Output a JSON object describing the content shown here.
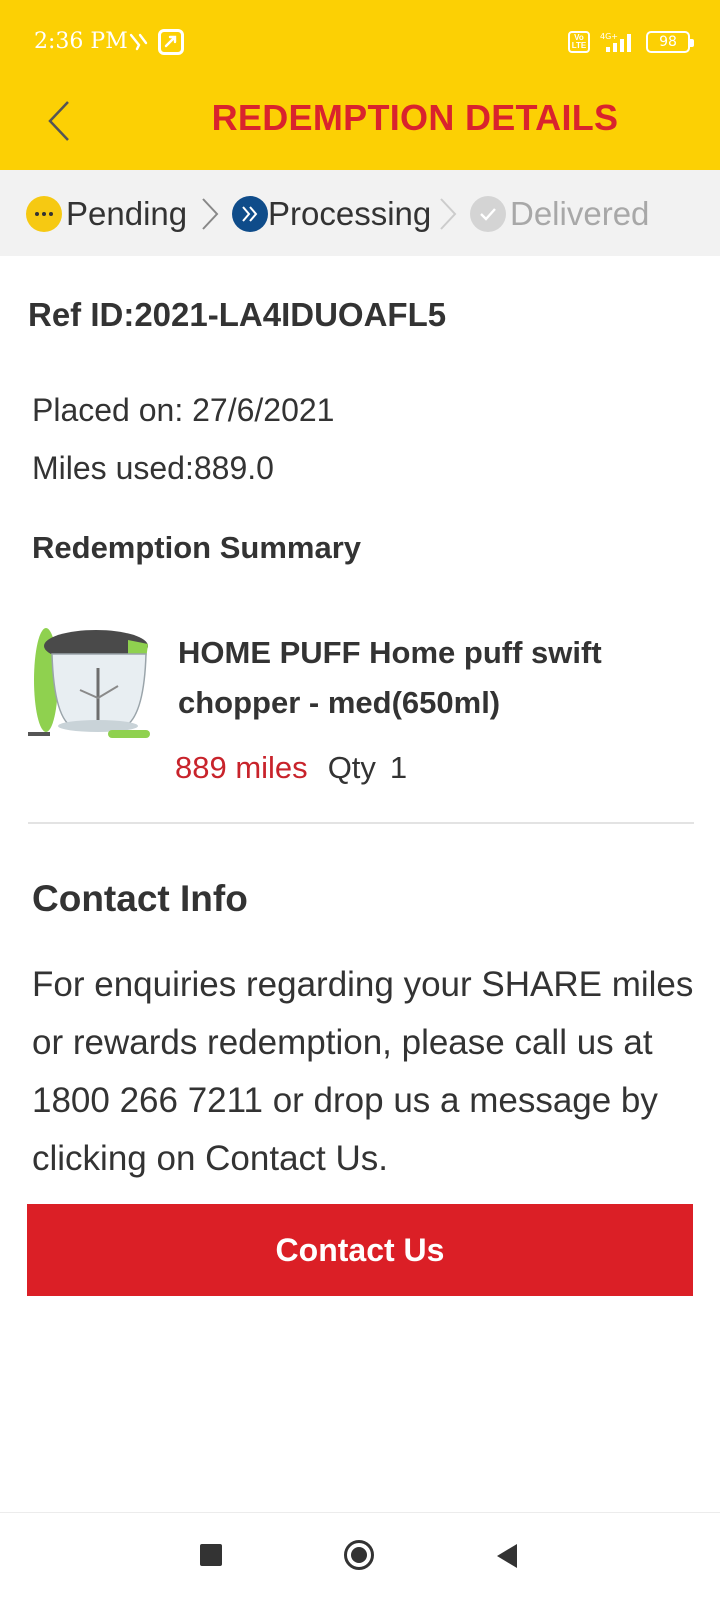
{
  "status_bar": {
    "time": "2:36 PM",
    "volte": "Vo LTE",
    "battery": "98"
  },
  "header": {
    "title": "REDEMPTION DETAILS",
    "background_color": "#FCD004",
    "title_color": "#D9232D"
  },
  "tracker": {
    "steps": [
      {
        "label": "Pending",
        "icon": "dots-icon",
        "color": "#F6C912",
        "state": "done"
      },
      {
        "label": "Processing",
        "icon": "double-chevron-icon",
        "color": "#0F4C8A",
        "state": "current"
      },
      {
        "label": "Delivered",
        "icon": "check-icon",
        "color": "#D4D4D4",
        "state": "upcoming"
      }
    ]
  },
  "order": {
    "ref_id": "Ref ID:2021-LA4IDUOAFL5",
    "placed_on": "Placed on: 27/6/2021",
    "miles_used": "Miles used:889.0"
  },
  "summary": {
    "title": "Redemption Summary",
    "items": [
      {
        "name": "HOME PUFF Home puff swift chopper - med(650ml)",
        "miles": "889 miles",
        "qty_label": "Qty",
        "qty": "1"
      }
    ]
  },
  "contact": {
    "title": "Contact Info",
    "text": "For enquiries regarding your SHARE miles or rewards redemption, please call us at 1800 266 7211 or drop us a message by clicking on Contact Us.",
    "button_label": "Contact Us",
    "button_color": "#DB1F26"
  }
}
